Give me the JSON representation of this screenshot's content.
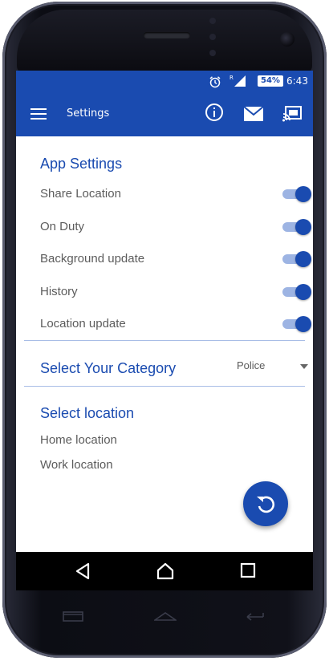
{
  "status_bar": {
    "alarm_icon": "alarm-clock-icon",
    "signal_icon": "cell-signal-icon",
    "signal_roaming": "R",
    "battery": "54%",
    "time": "6:43"
  },
  "app_bar": {
    "title": "Settings",
    "menu_icon": "hamburger-menu-icon",
    "actions": [
      "info-icon",
      "mail-icon",
      "cast-icon"
    ]
  },
  "app_settings": {
    "title": "App Settings",
    "items": [
      {
        "label": "Share Location",
        "enabled": true
      },
      {
        "label": "On Duty",
        "enabled": true
      },
      {
        "label": "Background update",
        "enabled": true
      },
      {
        "label": "History",
        "enabled": true
      },
      {
        "label": "Location update",
        "enabled": true
      }
    ]
  },
  "category": {
    "title": "Select Your Category",
    "selected": "Police"
  },
  "location": {
    "title": "Select location",
    "items": [
      "Home location",
      "Work location"
    ]
  },
  "fab": {
    "icon": "refresh-icon"
  },
  "nav_bar": {
    "buttons": [
      "back-icon",
      "home-icon",
      "recents-icon"
    ]
  },
  "colors": {
    "primary": "#1a4bb0",
    "toggle_track": "#9db4e3",
    "text": "#5c5c5c"
  }
}
